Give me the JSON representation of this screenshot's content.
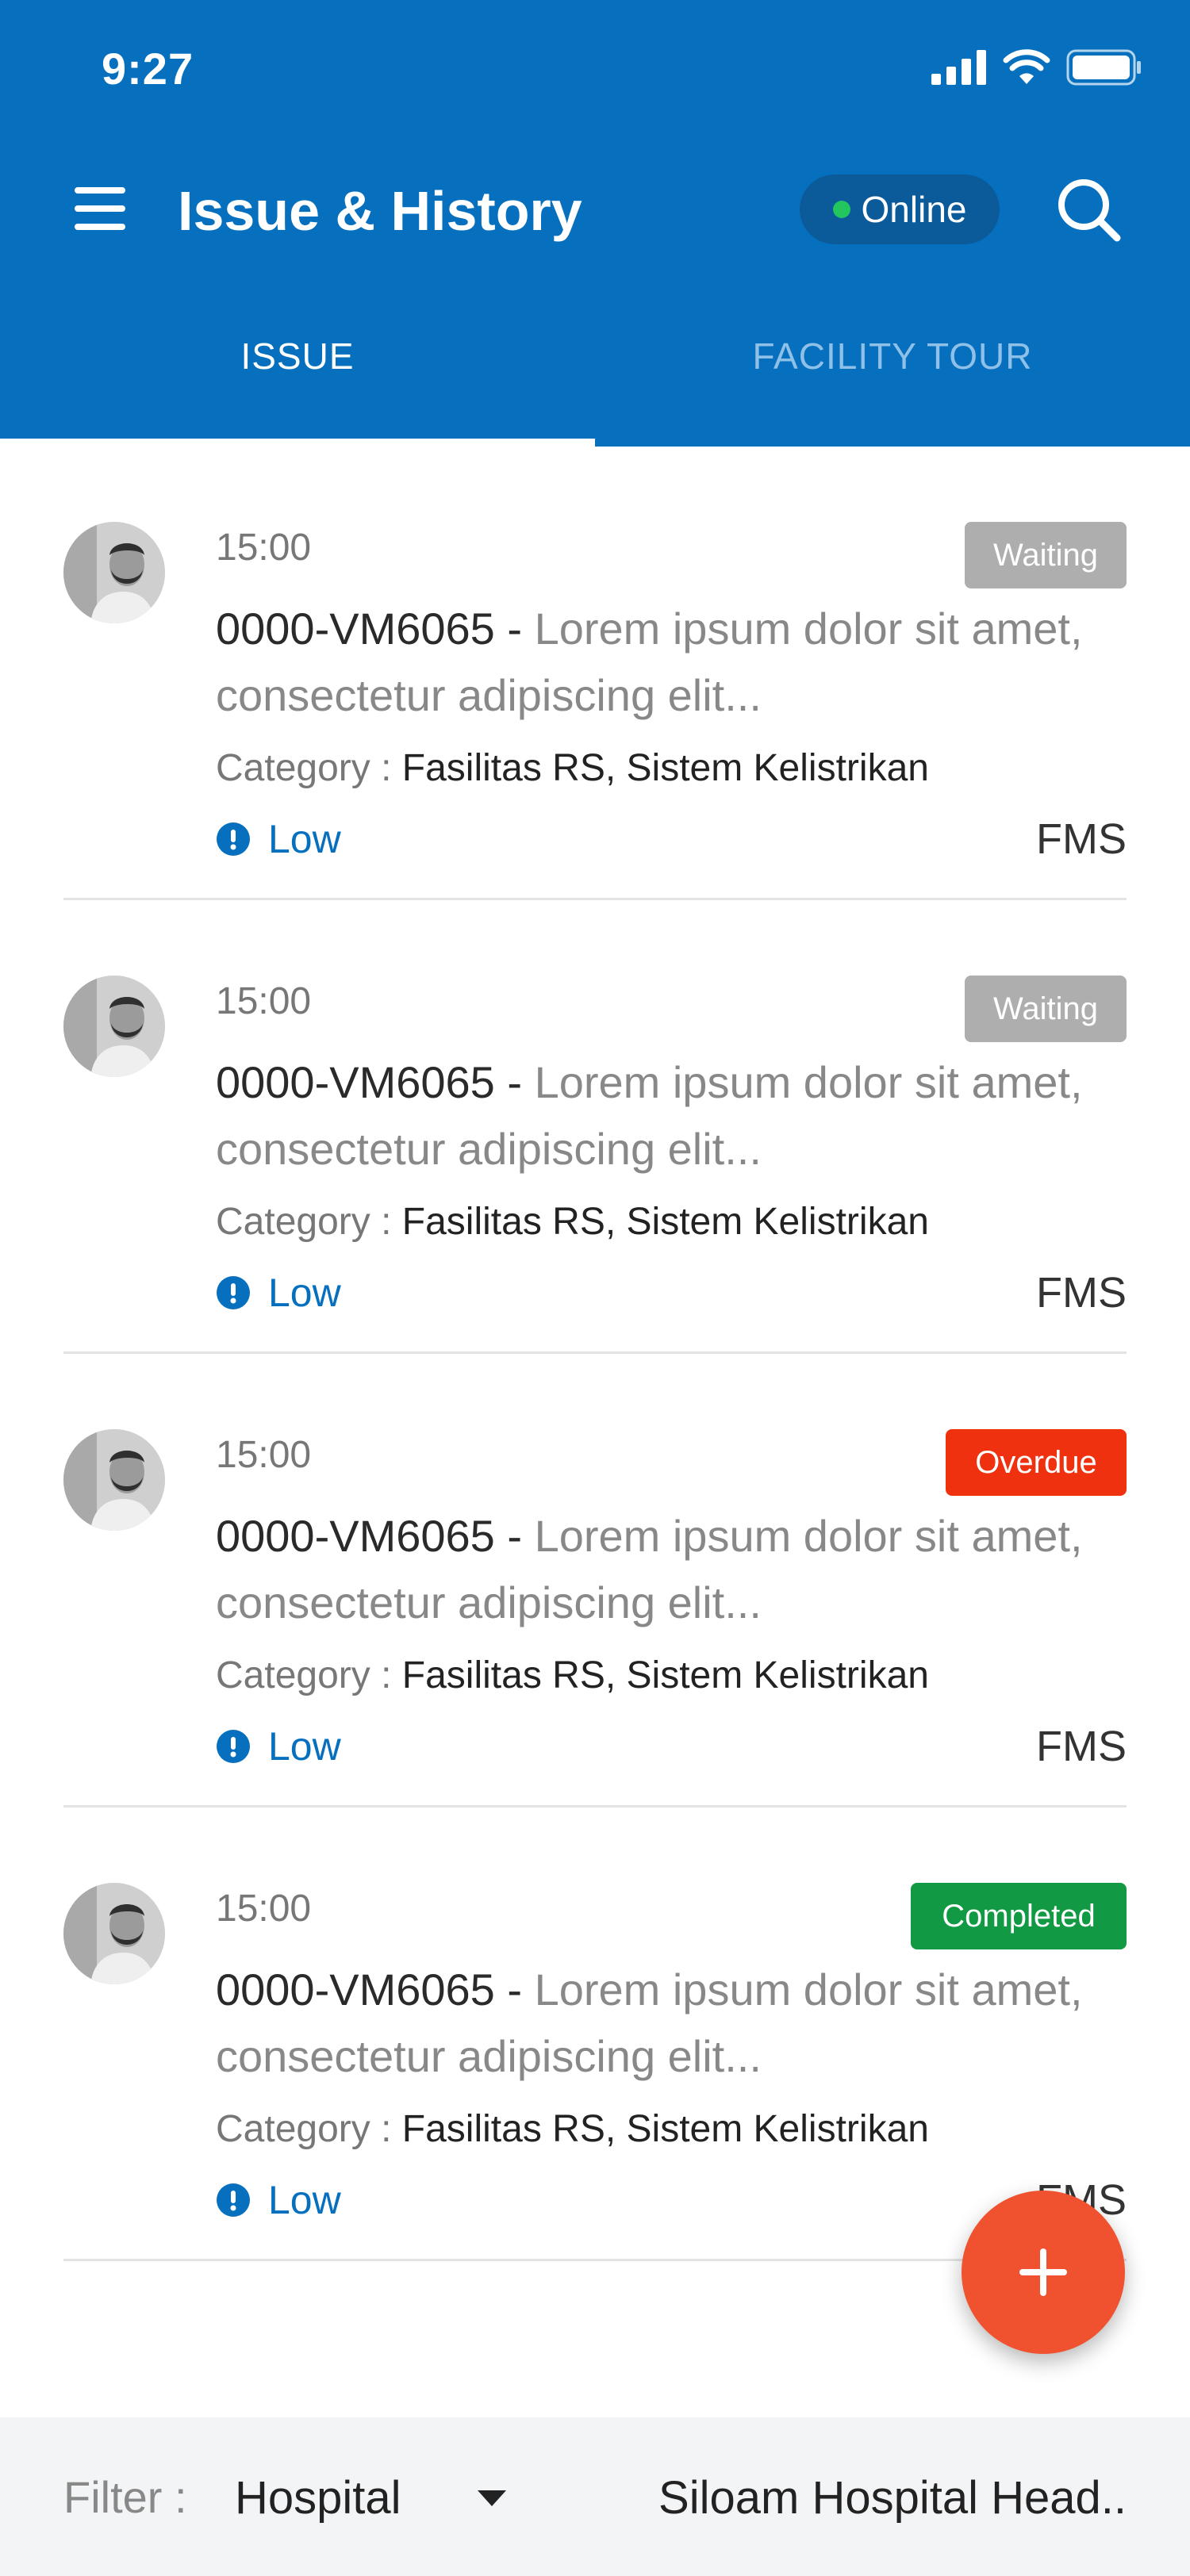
{
  "status_bar": {
    "time": "9:27",
    "icons": [
      "cellular-signal-icon",
      "wifi-icon",
      "battery-icon"
    ]
  },
  "header": {
    "title": "Issue & History",
    "status": "Online",
    "status_color": "#22c55e",
    "brand_color": "#0670bf"
  },
  "tabs": [
    {
      "label": "ISSUE",
      "active": true
    },
    {
      "label": "FACILITY TOUR",
      "active": false
    }
  ],
  "issues": [
    {
      "time": "15:00",
      "status": "Waiting",
      "code": "0000-VM6065",
      "separator": " - ",
      "description": "Lorem ipsum dolor sit amet, consectetur adipiscing elit...",
      "category_label": "Category :",
      "category": "Fasilitas RS, Sistem Kelistrikan",
      "priority": "Low",
      "department": "FMS"
    },
    {
      "time": "15:00",
      "status": "Waiting",
      "code": "0000-VM6065",
      "separator": " - ",
      "description": "Lorem ipsum dolor sit amet, consectetur adipiscing elit...",
      "category_label": "Category :",
      "category": "Fasilitas RS, Sistem Kelistrikan",
      "priority": "Low",
      "department": "FMS"
    },
    {
      "time": "15:00",
      "status": "Overdue",
      "code": "0000-VM6065",
      "separator": " - ",
      "description": "Lorem ipsum dolor sit amet, consectetur adipiscing elit...",
      "category_label": "Category :",
      "category": "Fasilitas RS, Sistem Kelistrikan",
      "priority": "Low",
      "department": "FMS"
    },
    {
      "time": "15:00",
      "status": "Completed",
      "code": "0000-VM6065",
      "separator": " - ",
      "description": "Lorem ipsum dolor sit amet, consectetur adipiscing elit...",
      "category_label": "Category :",
      "category": "Fasilitas RS, Sistem Kelistrikan",
      "priority": "Low",
      "department": "FMS"
    }
  ],
  "status_colors": {
    "Waiting": "#aeaeae",
    "Overdue": "#f0310f",
    "Completed": "#119a43"
  },
  "fab": {
    "icon": "plus-icon",
    "color": "#f0522f"
  },
  "filter": {
    "label": "Filter :",
    "type_value": "Hospital",
    "location_value": "Siloam Hospital Head.."
  }
}
